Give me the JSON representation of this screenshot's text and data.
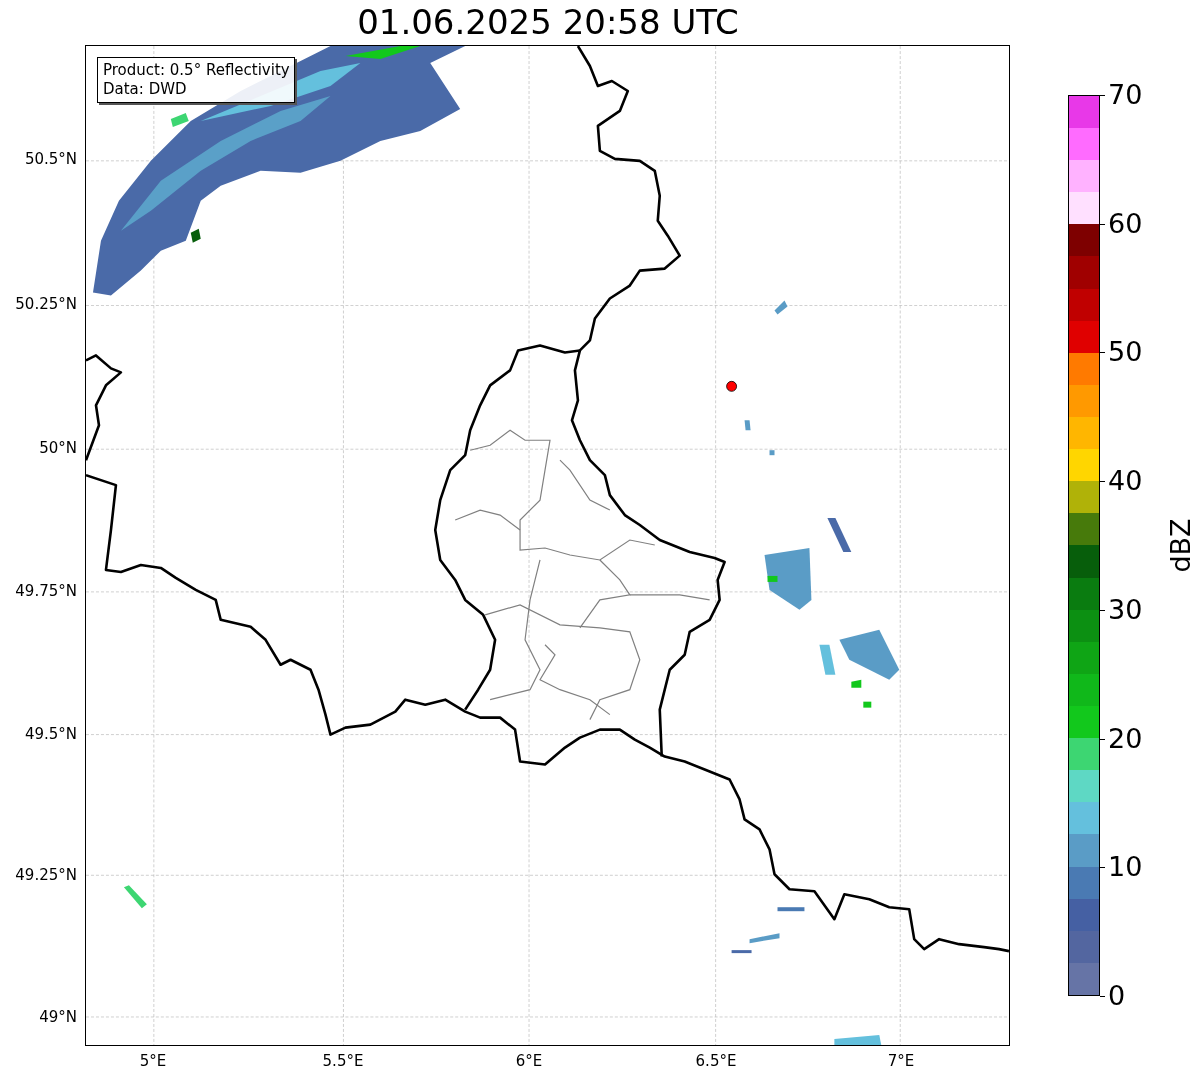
{
  "title": "01.06.2025 20:58 UTC",
  "info_box": {
    "lines": [
      "Product: 0.5° Reflectivity",
      "Data: DWD"
    ]
  },
  "lat_labels": [
    "50.5°N",
    "50.25°N",
    "50°N",
    "49.75°N",
    "49.5°N",
    "49.25°N",
    "49°N"
  ],
  "lon_labels": [
    "5°E",
    "5.5°E",
    "6°E",
    "6.5°E",
    "7°E"
  ],
  "colorbar": {
    "label": "dBZ",
    "ticks": [
      "70",
      "60",
      "50",
      "40",
      "30",
      "20",
      "10",
      "0"
    ],
    "segments": [
      {
        "color": "#6674a6"
      },
      {
        "color": "#5366a0"
      },
      {
        "color": "#4560a3"
      },
      {
        "color": "#4a7ab3"
      },
      {
        "color": "#5a9cc6"
      },
      {
        "color": "#64c0dd"
      },
      {
        "color": "#5ed8c4"
      },
      {
        "color": "#3dd672"
      },
      {
        "color": "#12c81c"
      },
      {
        "color": "#10b81a"
      },
      {
        "color": "#0fa515"
      },
      {
        "color": "#0c9012"
      },
      {
        "color": "#0a7c10"
      },
      {
        "color": "#075e0b"
      },
      {
        "color": "#477a0b"
      },
      {
        "color": "#b0b208"
      },
      {
        "color": "#ffd600"
      },
      {
        "color": "#ffb600"
      },
      {
        "color": "#ff9900"
      },
      {
        "color": "#ff7a00"
      },
      {
        "color": "#e00000"
      },
      {
        "color": "#c00000"
      },
      {
        "color": "#a00000"
      },
      {
        "color": "#7e0000"
      },
      {
        "color": "#ffe0ff"
      },
      {
        "color": "#ffb2ff"
      },
      {
        "color": "#ff6bff"
      },
      {
        "color": "#e838e8"
      }
    ]
  }
}
